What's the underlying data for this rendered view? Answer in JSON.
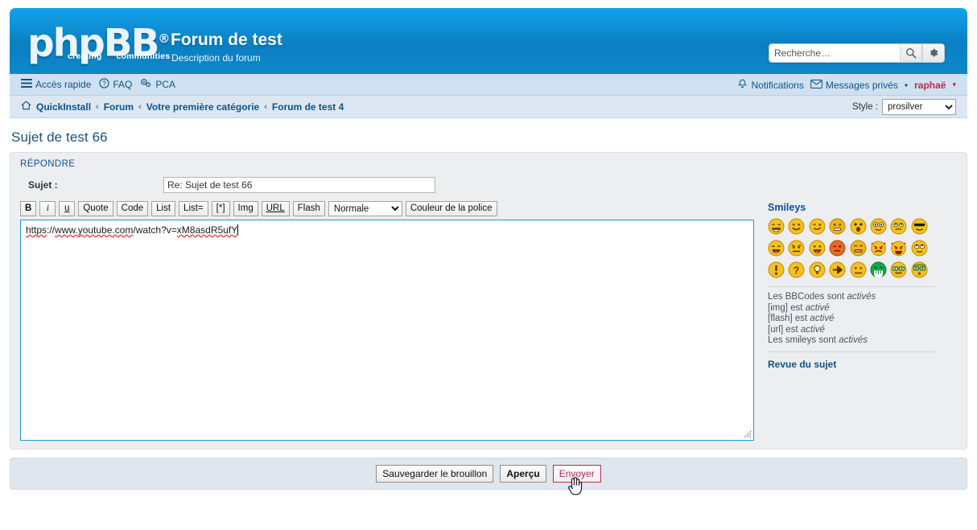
{
  "header": {
    "logo_text": "phpBB",
    "logo_reg": "®",
    "logo_tag_left": "creating",
    "logo_tag_right": "communities",
    "site_title": "Forum de test",
    "site_description": "Description du forum",
    "brand_color": "#0a7fc2",
    "search": {
      "placeholder": "Recherche…",
      "value": "",
      "search_icon": "search-icon",
      "options_icon": "gear-icon"
    }
  },
  "navbar": {
    "quick_access": {
      "label": "Accès rapide",
      "icon": "hamburger-icon"
    },
    "faq": {
      "label": "FAQ",
      "icon": "question-circle-icon"
    },
    "pca": {
      "label": "PCA",
      "icon": "cogs-icon"
    },
    "notifications": {
      "label": "Notifications",
      "icon": "bell-icon"
    },
    "private_messages": {
      "label": "Messages privés",
      "icon": "envelope-icon"
    },
    "separator": "•",
    "username": "raphaë",
    "user_caret": "▾"
  },
  "breadcrumb": {
    "home_icon": "home-icon",
    "separator": "‹",
    "items": [
      {
        "label": "QuickInstall"
      },
      {
        "label": "Forum"
      },
      {
        "label": "Votre première catégorie"
      },
      {
        "label": "Forum de test 4"
      }
    ]
  },
  "style_selector": {
    "label": "Style :",
    "selected": "prosilver",
    "options": [
      "prosilver"
    ]
  },
  "topic": {
    "title": "Sujet de test 66"
  },
  "reply_panel": {
    "heading": "RÉPONDRE",
    "subject_label": "Sujet :",
    "subject_value": "Re: Sujet de test 66"
  },
  "bbcode_toolbar": {
    "buttons": [
      {
        "label": "B",
        "name": "bbcode-bold-button",
        "style": "b"
      },
      {
        "label": "i",
        "name": "bbcode-italic-button",
        "style": "i"
      },
      {
        "label": "u",
        "name": "bbcode-underline-button",
        "style": "u"
      },
      {
        "label": "Quote",
        "name": "bbcode-quote-button",
        "style": ""
      },
      {
        "label": "Code",
        "name": "bbcode-code-button",
        "style": ""
      },
      {
        "label": "List",
        "name": "bbcode-list-button",
        "style": ""
      },
      {
        "label": "List=",
        "name": "bbcode-orderedlist-button",
        "style": ""
      },
      {
        "label": "[*]",
        "name": "bbcode-listitem-button",
        "style": ""
      },
      {
        "label": "Img",
        "name": "bbcode-image-button",
        "style": ""
      },
      {
        "label": "URL",
        "name": "bbcode-url-button",
        "style": "url"
      },
      {
        "label": "Flash",
        "name": "bbcode-flash-button",
        "style": ""
      }
    ],
    "font_size": {
      "selected": "Normale",
      "options": [
        "Normale"
      ]
    },
    "font_color_label": "Couleur de la police"
  },
  "message": {
    "text": "https://www.youtube.com/watch?v=xM8asdR5ufY",
    "segments": [
      {
        "t": "https",
        "spell": true
      },
      {
        "t": "://",
        "spell": false
      },
      {
        "t": "www.youtube.com",
        "spell": true
      },
      {
        "t": "/watch?v=",
        "spell": false
      },
      {
        "t": "xM8asdR5ufY",
        "spell": true
      }
    ],
    "border_color": "#1c9ada"
  },
  "sidebar": {
    "smileys_heading": "Smileys",
    "smileys": [
      {
        "name": "smiley-very-happy",
        "face": "#f5c21e",
        "type": "grin"
      },
      {
        "name": "smiley-smile",
        "face": "#f5c21e",
        "type": "smile"
      },
      {
        "name": "smiley-wink",
        "face": "#f5c21e",
        "type": "wink"
      },
      {
        "name": "smiley-sad",
        "face": "#f0b61a",
        "type": "sad"
      },
      {
        "name": "smiley-surprised",
        "face": "#f5c21e",
        "type": "surprised"
      },
      {
        "name": "smiley-shocked",
        "face": "#f5c21e",
        "type": "shocked"
      },
      {
        "name": "smiley-confused",
        "face": "#f5c21e",
        "type": "confused"
      },
      {
        "name": "smiley-cool",
        "face": "#f5c21e",
        "type": "cool"
      },
      {
        "name": "smiley-laughing",
        "face": "#f5c21e",
        "type": "laugh"
      },
      {
        "name": "smiley-mad",
        "face": "#f5c21e",
        "type": "mad"
      },
      {
        "name": "smiley-razz",
        "face": "#f5c21e",
        "type": "razz"
      },
      {
        "name": "smiley-embarrassed",
        "face": "#ec6a22",
        "type": "embarrassed"
      },
      {
        "name": "smiley-crying",
        "face": "#f0b61a",
        "type": "crying"
      },
      {
        "name": "smiley-evil",
        "face": "#f5c21e",
        "type": "evil"
      },
      {
        "name": "smiley-twisted",
        "face": "#f5c21e",
        "type": "twisted"
      },
      {
        "name": "smiley-rolling-eyes",
        "face": "#f5c21e",
        "type": "rolleyes"
      },
      {
        "name": "smiley-exclamation",
        "face": "#f5c21e",
        "type": "exclaim"
      },
      {
        "name": "smiley-question",
        "face": "#f5c21e",
        "type": "question"
      },
      {
        "name": "smiley-idea",
        "face": "#f5c21e",
        "type": "idea"
      },
      {
        "name": "smiley-arrow",
        "face": "#f5c21e",
        "type": "arrow"
      },
      {
        "name": "smiley-neutral",
        "face": "#f5c21e",
        "type": "neutral"
      },
      {
        "name": "smiley-mrgreen",
        "face": "#14a84a",
        "type": "mrgreen"
      },
      {
        "name": "smiley-geek",
        "face": "#f5c21e",
        "type": "geek"
      },
      {
        "name": "smiley-ugeek",
        "face": "#f5c21e",
        "type": "ugeek"
      }
    ],
    "bbcode_status": [
      {
        "prefix": "Les BBCodes sont ",
        "state": "activés"
      },
      {
        "prefix": "[img] est ",
        "state": "activé"
      },
      {
        "prefix": "[flash] est ",
        "state": "activé"
      },
      {
        "prefix": "[url] est ",
        "state": "activé"
      },
      {
        "prefix": "Les smileys sont ",
        "state": "activés"
      }
    ],
    "review_link": "Revue du sujet"
  },
  "actions": {
    "save_draft": "Sauvegarder le brouillon",
    "preview": "Aperçu",
    "submit": "Envoyer",
    "submit_hover_color": "#bc2a4d"
  }
}
